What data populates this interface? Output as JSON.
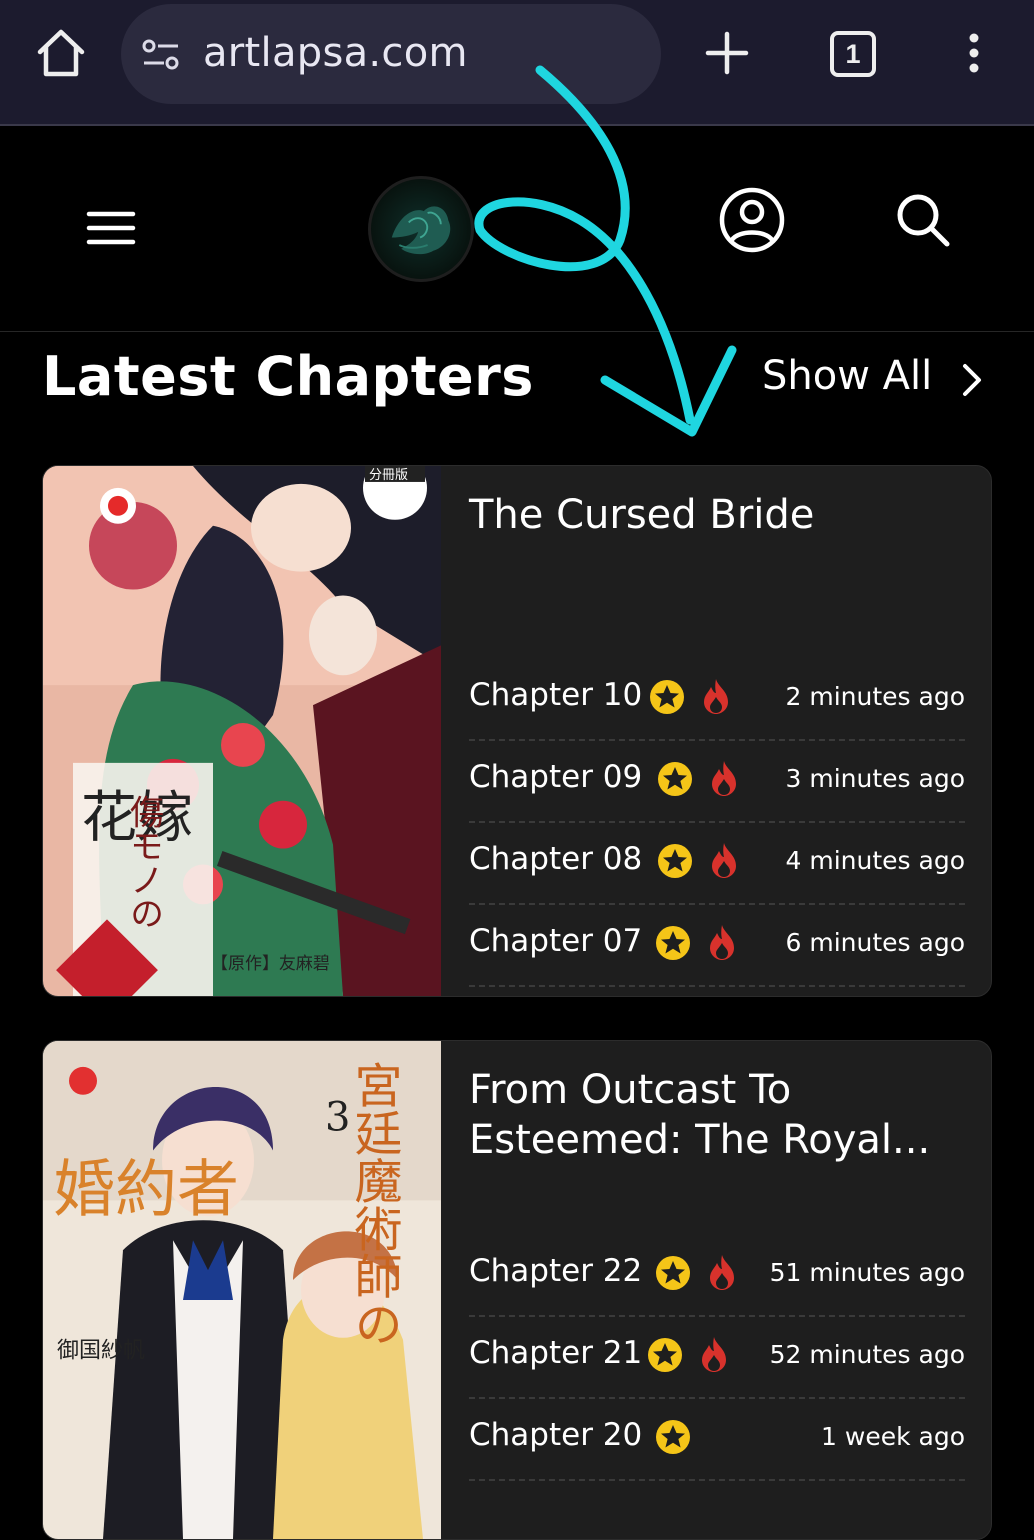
{
  "browser": {
    "url": "artlapsa.com",
    "tab_count": "1"
  },
  "section": {
    "title": "Latest Chapters",
    "show_all_label": "Show All"
  },
  "colors": {
    "accent_annotation": "#1fd6e0",
    "star_badge": "#f5c518",
    "fire_badge": "#d8322c",
    "card_bg": "#1e1e1e"
  },
  "cards": [
    {
      "title": "The Cursed Bride",
      "cover_texts": {
        "badge": "分冊版",
        "title_jp_1": "傷モノの",
        "title_jp_2": "花嫁",
        "credits": "【原作】友麻碧"
      },
      "chapters": [
        {
          "label": "Chapter 10",
          "time": "2 minutes ago",
          "star": true,
          "fire": true
        },
        {
          "label": "Chapter 09",
          "time": "3 minutes ago",
          "star": true,
          "fire": true
        },
        {
          "label": "Chapter 08",
          "time": "4 minutes ago",
          "star": true,
          "fire": true
        },
        {
          "label": "Chapter 07",
          "time": "6 minutes ago",
          "star": true,
          "fire": true
        }
      ]
    },
    {
      "title": "From Outcast To Esteemed: The Royal...",
      "cover_texts": {
        "volume": "3",
        "title_jp_1": "宮廷魔術師の",
        "title_jp_2": "婚約者",
        "author": "御国紗帆"
      },
      "chapters": [
        {
          "label": "Chapter 22",
          "time": "51 minutes ago",
          "star": true,
          "fire": true
        },
        {
          "label": "Chapter 21",
          "time": "52 minutes ago",
          "star": true,
          "fire": true
        },
        {
          "label": "Chapter 20",
          "time": "1 week ago",
          "star": true,
          "fire": false
        }
      ]
    }
  ]
}
